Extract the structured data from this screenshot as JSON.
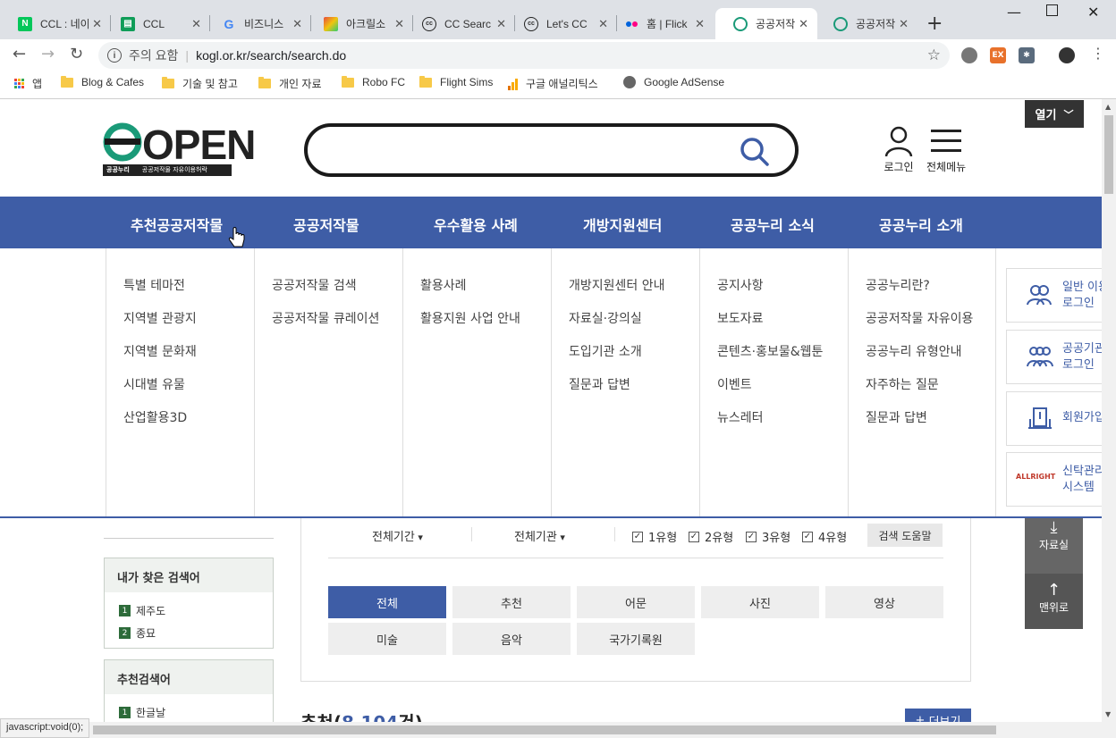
{
  "browser": {
    "tabs": [
      {
        "label": "CCL : 네이",
        "icon": "naver-icon",
        "color": "#03c75a"
      },
      {
        "label": "CCL",
        "icon": "sheets-icon",
        "color": "#0f9d58"
      },
      {
        "label": "비즈니스",
        "icon": "google-icon",
        "color": "#4285f4"
      },
      {
        "label": "아크릴소",
        "icon": "acrylic-icon",
        "color": "#d9534f"
      },
      {
        "label": "CC Searc",
        "icon": "cc-icon",
        "color": "#222222"
      },
      {
        "label": "Let's CC",
        "icon": "cc-icon",
        "color": "#222222"
      },
      {
        "label": "홈 | Flick",
        "icon": "flickr-icon",
        "color": "#ff0084"
      },
      {
        "label": "공공저작",
        "icon": "kogl-icon",
        "color": "#1a9a78",
        "active": true
      },
      {
        "label": "공공저작",
        "icon": "kogl-icon",
        "color": "#1a9a78"
      }
    ],
    "security_warning": "주의 요함",
    "url": "kogl.or.kr/search/search.do",
    "bookmarks": [
      {
        "label": "앱",
        "type": "apps"
      },
      {
        "label": "Blog & Cafes",
        "type": "folder"
      },
      {
        "label": "기술 및 참고",
        "type": "folder"
      },
      {
        "label": "개인 자료",
        "type": "folder"
      },
      {
        "label": "Robo FC",
        "type": "folder"
      },
      {
        "label": "Flight Sims",
        "type": "folder"
      },
      {
        "label": "구글 애널리틱스",
        "type": "analytics"
      },
      {
        "label": "Google AdSense",
        "type": "globe"
      }
    ],
    "status_text": "javascript:void(0);"
  },
  "header": {
    "logo_text": "OPEN",
    "logo_sub_left": "공공누리",
    "logo_sub_right": "공공저작물 자유이용허락",
    "login_label": "로그인",
    "allmenu_label": "전체메뉴",
    "open_label": "열기"
  },
  "nav": [
    "추천공공저작물",
    "공공저작물",
    "우수활용 사례",
    "개방지원센터",
    "공공누리 소식",
    "공공누리 소개"
  ],
  "mega_menu": [
    [
      "특별 테마전",
      "지역별 관광지",
      "지역별 문화재",
      "시대별 유물",
      "산업활용3D"
    ],
    [
      "공공저작물 검색",
      "공공저작물 큐레이션"
    ],
    [
      "활용사례",
      "활용지원 사업 안내"
    ],
    [
      "개방지원센터 안내",
      "자료실·강의실",
      "도입기관 소개",
      "질문과 답변"
    ],
    [
      "공지사항",
      "보도자료",
      "콘텐츠·홍보물&웹툰",
      "이벤트",
      "뉴스레터"
    ],
    [
      "공공누리란?",
      "공공저작물 자유이용",
      "공공누리 유형안내",
      "자주하는 질문",
      "질문과 답변"
    ]
  ],
  "side_cards": [
    {
      "label": "일반 이용\n로그인",
      "icon": "user-icon"
    },
    {
      "label": "공공기관\n로그인",
      "icon": "users-icon"
    },
    {
      "label": "회원가입",
      "icon": "building-icon"
    },
    {
      "label": "신탁관리\n시스템",
      "icon": "allright-logo",
      "logo_text": "ALLRIGHT"
    }
  ],
  "keywords": {
    "my_title": "내가 찾은 검색어",
    "my_items": [
      {
        "num": "1",
        "text": "제주도"
      },
      {
        "num": "2",
        "text": "종묘"
      }
    ],
    "rec_title": "추천검색어",
    "rec_items": [
      {
        "num": "1",
        "text": "한글날"
      }
    ]
  },
  "filters": {
    "period": "전체기간",
    "agency": "전체기관",
    "types": [
      "1유형",
      "2유형",
      "3유형",
      "4유형"
    ],
    "help_label": "검색 도움말",
    "categories": [
      "전체",
      "추천",
      "어문",
      "사진",
      "영상",
      "미술",
      "음악",
      "국가기록원"
    ],
    "selected": "전체"
  },
  "side_tools": {
    "archive_label": "자료실",
    "top_label": "맨위로"
  },
  "results": {
    "title": "추천",
    "count": "8,104",
    "suffix": "건",
    "more_label": "더보기"
  },
  "colors": {
    "brand_blue": "#3e5da6",
    "brand_green": "#1a9a78"
  }
}
